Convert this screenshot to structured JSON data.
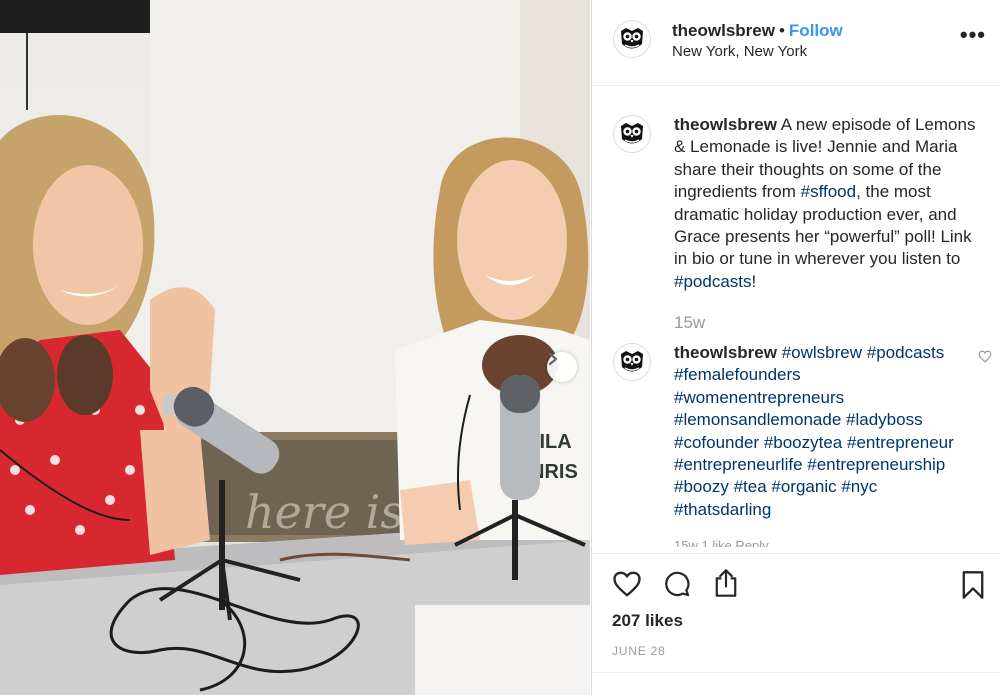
{
  "post": {
    "username": "theowlsbrew",
    "follow_label": "Follow",
    "separator": "•",
    "location": "New York, New York",
    "more_label": "•••"
  },
  "caption": {
    "username": "theowlsbrew",
    "parts": [
      {
        "text": " A new episode of Lemons & Lemonade is live! Jennie and Maria share their thoughts on some of the ingredients from ",
        "tag": false
      },
      {
        "text": "#sffood",
        "tag": true
      },
      {
        "text": ", the most dramatic holiday production ever, and Grace presents her “powerful” poll! Link in bio or tune in wherever you listen to ",
        "tag": false
      },
      {
        "text": "#podcasts",
        "tag": true
      },
      {
        "text": "!",
        "tag": false
      }
    ],
    "age": "15w"
  },
  "hashtag_comment": {
    "username": "theowlsbrew",
    "tags": [
      "#owlsbrew",
      "#podcasts",
      "#femalefounders",
      "#womenentrepreneurs",
      "#lemonsandlemonade",
      "#ladyboss",
      "#cofounder",
      "#boozytea",
      "#entrepreneur",
      "#entrepreneurlife",
      "#entrepreneurship",
      "#boozy",
      "#tea",
      "#organic",
      "#nyc",
      "#thatsdarling"
    ],
    "meta": "15w   1 like   Reply"
  },
  "stats": {
    "likes": "207 likes",
    "date": "JUNE 28"
  },
  "photo": {
    "sign_text": "here is"
  },
  "colors": {
    "follow": "#3897f0",
    "hashtag": "#003569",
    "muted": "#999999"
  },
  "icons": {
    "like": "heart-icon",
    "comment": "comment-icon",
    "share": "share-icon",
    "save": "bookmark-icon",
    "next": "chevron-right-icon",
    "avatar": "owl-logo-icon"
  }
}
